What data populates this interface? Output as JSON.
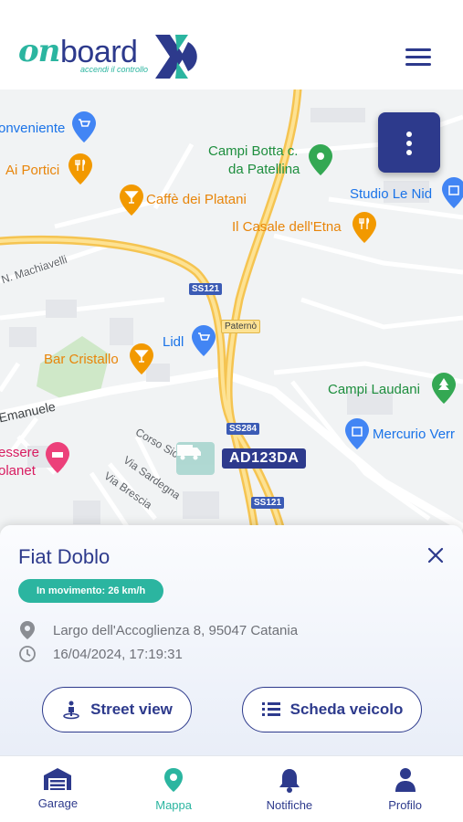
{
  "header": {
    "logo_on": "on",
    "logo_board": "board",
    "logo_tagline": "accendi il controllo",
    "menu_icon": "hamburger-menu-icon"
  },
  "map": {
    "pois": {
      "conveniente": "onveniente",
      "ai_portici": "Ai Portici",
      "caffe": "Caffè dei Platani",
      "campi_botta_line1": "Campi Botta c.",
      "campi_botta_line2": "da Patellina",
      "studio": "Studio Le Nid",
      "casale": "Il Casale dell'Etna",
      "lidl": "Lidl",
      "bar_cristallo": "Bar Cristallo",
      "campi_laudani": "Campi Laudani",
      "mercurio": "Mercurio Verr",
      "essere_line1": "essere",
      "essere_line2": "olanet"
    },
    "roads": {
      "machiavelli": "N. Machiavelli",
      "emanuele": "Emanuele",
      "corso": "Corso Sic",
      "sardegna": "Via Sardegna",
      "brescia": "Via Brescia"
    },
    "shields": {
      "ss121_top": "SS121",
      "ss284": "SS284",
      "ss121_bottom": "SS121",
      "paterno": "Paternò"
    },
    "vehicle_plate": "AD123DA"
  },
  "sheet": {
    "title": "Fiat Doblo",
    "status": "In movimento: 26 km/h",
    "address": "Largo dell'Accoglienza 8, 95047 Catania",
    "timestamp": "16/04/2024, 17:19:31",
    "street_view_label": "Street view",
    "vehicle_card_label": "Scheda veicolo"
  },
  "tabs": [
    {
      "label": "Garage",
      "icon": "garage-icon",
      "active": false
    },
    {
      "label": "Mappa",
      "icon": "map-pin-icon",
      "active": true
    },
    {
      "label": "Notifiche",
      "icon": "bell-icon",
      "active": false
    },
    {
      "label": "Profilo",
      "icon": "user-icon",
      "active": false
    }
  ],
  "colors": {
    "brand_navy": "#2d3a8c",
    "brand_teal": "#2bb5a0"
  }
}
